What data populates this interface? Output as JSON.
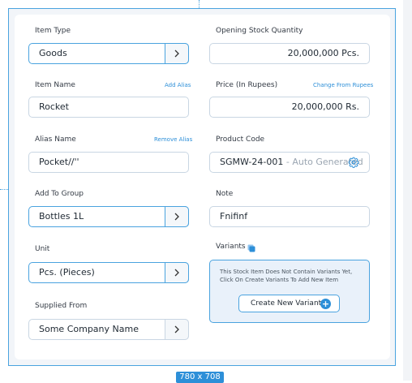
{
  "dimension_badge": "780 x 708",
  "left": {
    "item_type": {
      "label": "Item Type",
      "value": "Goods"
    },
    "item_name": {
      "label": "Item Name",
      "link": "Add Alias",
      "value": "Rocket"
    },
    "alias_name": {
      "label": "Alias Name",
      "link": "Remove Alias",
      "value": "Pocket//''"
    },
    "add_to_group": {
      "label": "Add To Group",
      "value": "Bottles 1L"
    },
    "unit": {
      "label": "Unit",
      "value": "Pcs. (Pieces)"
    },
    "supplied_from": {
      "label": "Supplied From",
      "value": "Some Company Name"
    }
  },
  "right": {
    "opening_stock": {
      "label": "Opening Stock Quantity",
      "value": "20,000,000 Pcs."
    },
    "price": {
      "label": "Price (In Rupees)",
      "link": "Change From Rupees",
      "value": "20,000,000 Rs."
    },
    "product_code": {
      "label": "Product Code",
      "value": "SGMW-24-001",
      "suffix": " - Auto Generated"
    },
    "note": {
      "label": "Note",
      "value": "Fnifinf"
    },
    "variants": {
      "label": "Variants",
      "message": "This Stock Item Does Not Contain Variants Yet, Click On Create Variants To Add New Item",
      "button": "Create New Variant",
      "button_icon": "plus-circle-icon"
    }
  },
  "icons": {
    "select_chevron": "chevron-right-icon",
    "settings": "gear-icon",
    "variants_info": "copy-icon"
  },
  "colors": {
    "accent": "#2d8fd8",
    "border": "#c9d6e3",
    "selection_border": "#4aa3df"
  }
}
